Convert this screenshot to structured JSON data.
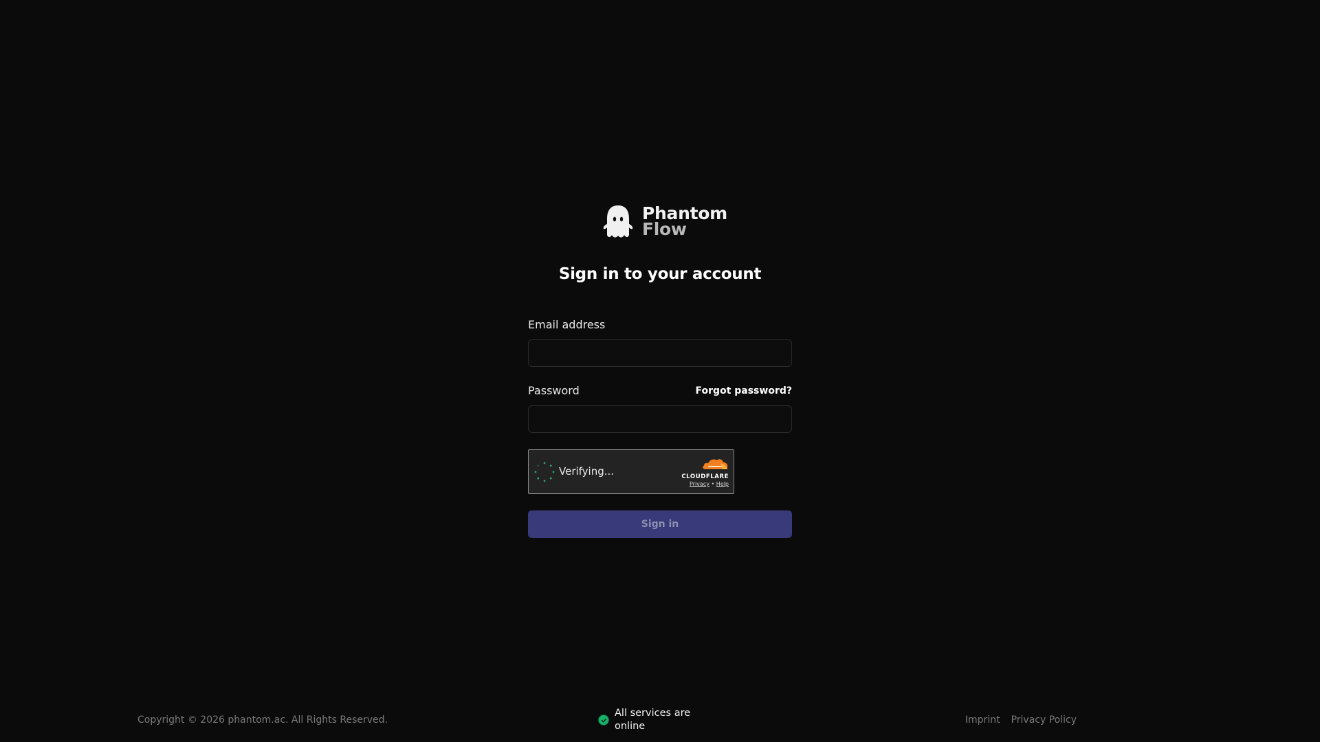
{
  "brand": {
    "line1": "Phantom",
    "line2": "Flow"
  },
  "heading": "Sign in to your account",
  "form": {
    "email_label": "Email address",
    "email_value": "",
    "password_label": "Password",
    "password_value": "",
    "forgot_label": "Forgot password?",
    "submit_label": "Sign in"
  },
  "captcha": {
    "status": "Verifying...",
    "provider": "CLOUDFLARE",
    "privacy_label": "Privacy",
    "separator": "•",
    "help_label": "Help"
  },
  "footer": {
    "copyright": "Copyright © 2026 phantom.ac. All Rights Reserved.",
    "status_text": "All services are online",
    "links": [
      "Imprint",
      "Privacy Policy"
    ]
  },
  "colors": {
    "background": "#0b0b0b",
    "accent": "#383a7a",
    "status_ok": "#17b26a",
    "cloudflare_orange": "#f38020"
  },
  "icons": {
    "logo": "ghost-icon",
    "captcha_spinner": "spinner-icon",
    "captcha_provider": "cloudflare-cloud-icon",
    "status": "check-circle-icon"
  }
}
